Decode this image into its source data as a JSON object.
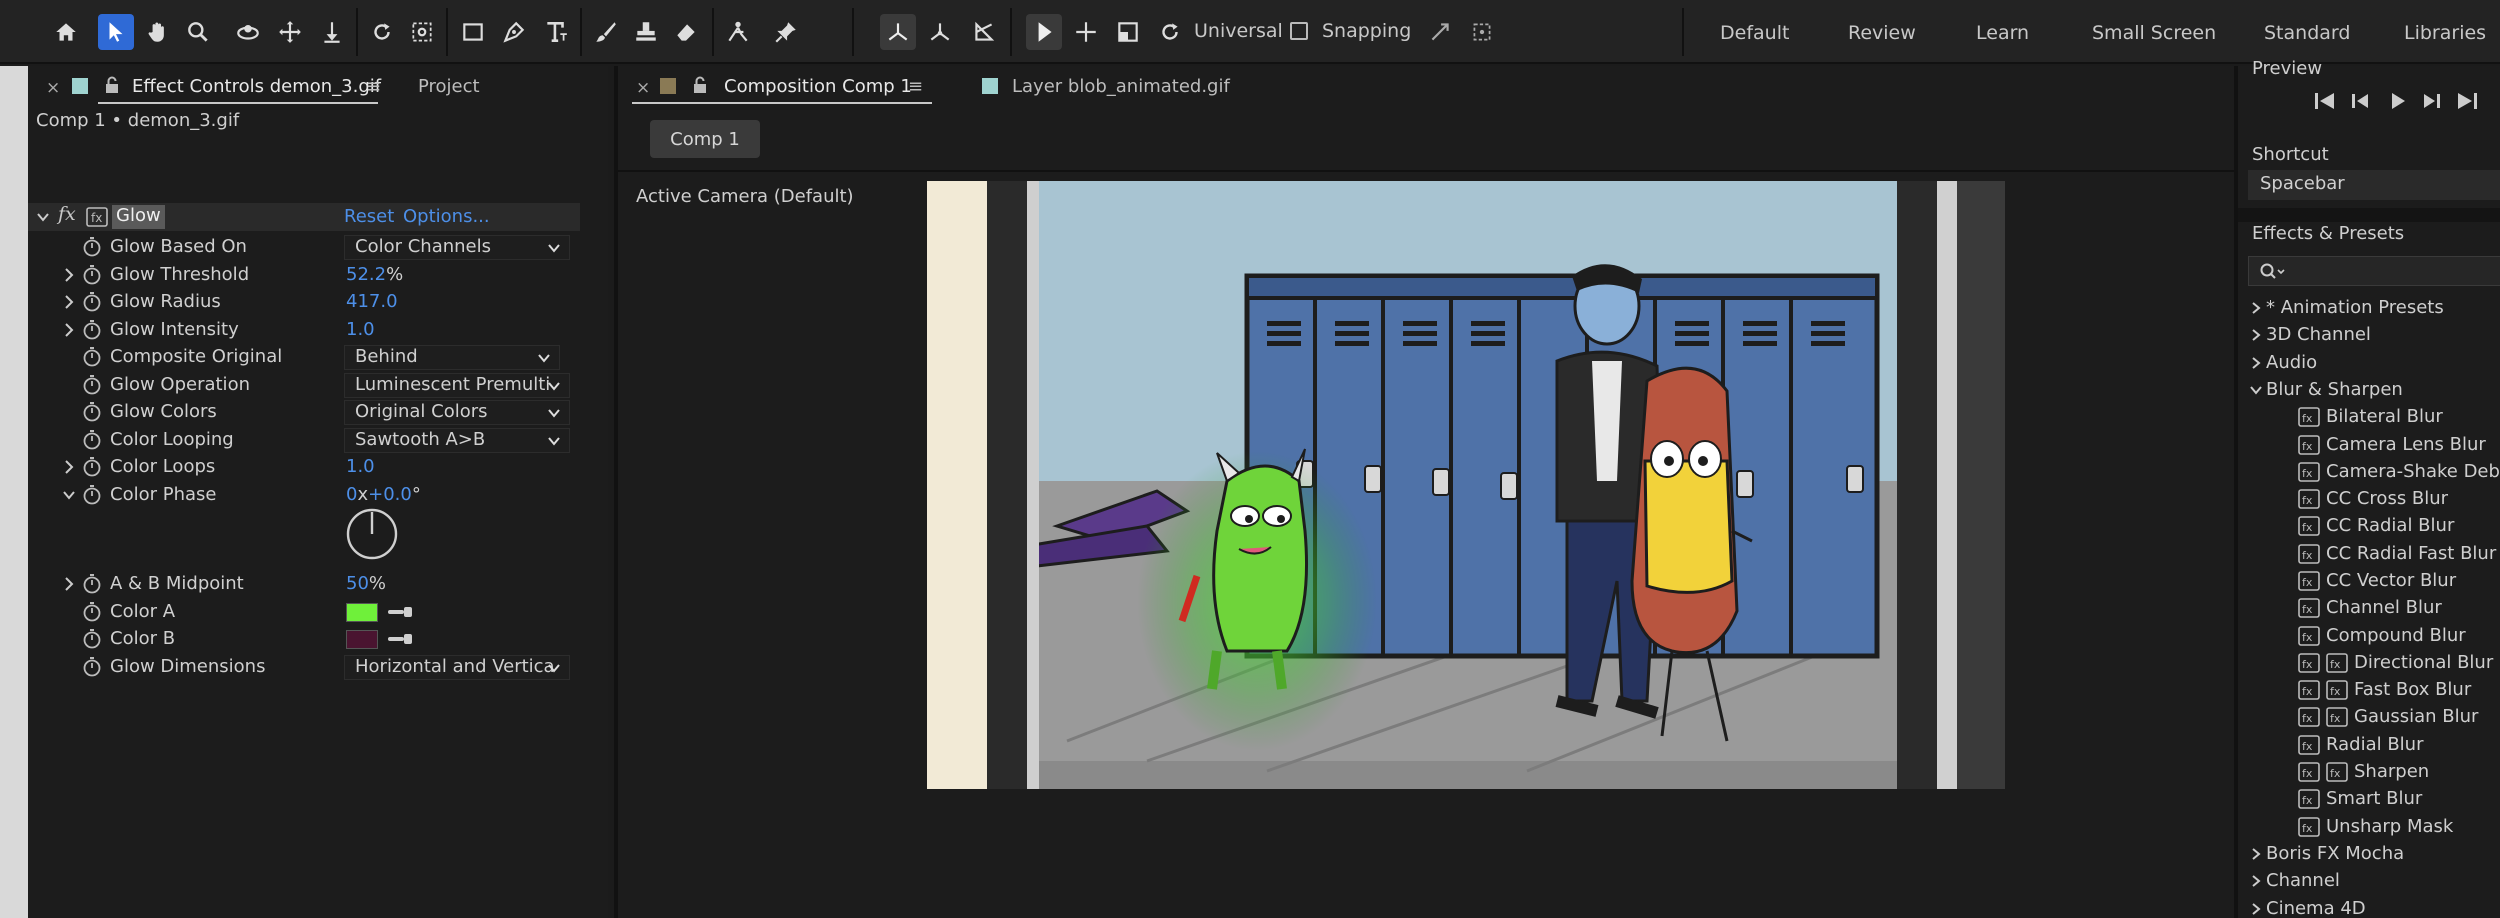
{
  "toolbar": {
    "universal_label": "Universal",
    "snapping_label": "Snapping",
    "workspaces": [
      "Default",
      "Review",
      "Learn",
      "Small Screen",
      "Standard",
      "Libraries"
    ]
  },
  "effect_controls": {
    "tab_label": "Effect Controls demon_3.gif",
    "project_tab": "Project",
    "breadcrumb": "Comp 1 • demon_3.gif",
    "effect_name": "Glow",
    "fx_label": "fx",
    "reset_label": "Reset",
    "options_label": "Options...",
    "params": [
      {
        "name": "Glow Based On",
        "kind": "dropdown",
        "value": "Color Channels"
      },
      {
        "name": "Glow Threshold",
        "kind": "number",
        "value": "52.2",
        "unit": "%",
        "expandable": true
      },
      {
        "name": "Glow Radius",
        "kind": "number",
        "value": "417.0",
        "unit": "",
        "expandable": true
      },
      {
        "name": "Glow Intensity",
        "kind": "number",
        "value": "1.0",
        "unit": "",
        "expandable": true
      },
      {
        "name": "Composite Original",
        "kind": "dropdown",
        "value": "Behind"
      },
      {
        "name": "Glow Operation",
        "kind": "dropdown",
        "value": "Luminescent Premulti"
      },
      {
        "name": "Glow Colors",
        "kind": "dropdown",
        "value": "Original Colors"
      },
      {
        "name": "Color Looping",
        "kind": "dropdown",
        "value": "Sawtooth A>B"
      },
      {
        "name": "Color Loops",
        "kind": "number",
        "value": "1.0",
        "unit": "",
        "expandable": true
      },
      {
        "name": "Color Phase",
        "kind": "phase",
        "value_a": "0",
        "value_x": "x",
        "value_b": "+0.0",
        "unit": "°",
        "expanded": true
      }
    ],
    "params2": [
      {
        "name": "A & B Midpoint",
        "kind": "number",
        "value": "50",
        "unit": "%",
        "expandable": true
      },
      {
        "name": "Color A",
        "kind": "color",
        "color": "#6ff03a"
      },
      {
        "name": "Color B",
        "kind": "color",
        "color": "#4a1430"
      },
      {
        "name": "Glow Dimensions",
        "kind": "dropdown",
        "value": "Horizontal and Vertica"
      }
    ]
  },
  "composition": {
    "tab_label": "Composition Comp 1",
    "layer_tab": "Layer blob_animated.gif",
    "comp_button": "Comp 1",
    "camera_label": "Active Camera (Default)"
  },
  "right_panel": {
    "preview_label": "Preview",
    "shortcut_label": "Shortcut",
    "shortcut_value": "Spacebar",
    "effects_title": "Effects & Presets",
    "tree": [
      {
        "label": "* Animation Presets",
        "open": false
      },
      {
        "label": "3D Channel",
        "open": false
      },
      {
        "label": "Audio",
        "open": false
      },
      {
        "label": "Blur & Sharpen",
        "open": true
      }
    ],
    "blur_items": [
      {
        "label": "Bilateral Blur",
        "extra": false
      },
      {
        "label": "Camera Lens Blur",
        "extra": false
      },
      {
        "label": "Camera-Shake Deblur",
        "extra": false
      },
      {
        "label": "CC Cross Blur",
        "extra": false
      },
      {
        "label": "CC Radial Blur",
        "extra": false
      },
      {
        "label": "CC Radial Fast Blur",
        "extra": false
      },
      {
        "label": "CC Vector Blur",
        "extra": false
      },
      {
        "label": "Channel Blur",
        "extra": false
      },
      {
        "label": "Compound Blur",
        "extra": false
      },
      {
        "label": "Directional Blur",
        "extra": true
      },
      {
        "label": "Fast Box Blur",
        "extra": true
      },
      {
        "label": "Gaussian Blur",
        "extra": true
      },
      {
        "label": "Radial Blur",
        "extra": false
      },
      {
        "label": "Sharpen",
        "extra": true
      },
      {
        "label": "Smart Blur",
        "extra": false
      },
      {
        "label": "Unsharp Mask",
        "extra": false
      }
    ],
    "tree_after": [
      {
        "label": "Boris FX Mocha",
        "open": false
      },
      {
        "label": "Channel",
        "open": false
      },
      {
        "label": "Cinema 4D",
        "open": false
      }
    ]
  },
  "colors": {
    "accent": "#2f6ad6",
    "value_blue": "#4d8fe8",
    "ec_swatch": "#9fd3d0",
    "comp_swatch": "#8a7a55",
    "layer_swatch": "#9fd3d0"
  }
}
